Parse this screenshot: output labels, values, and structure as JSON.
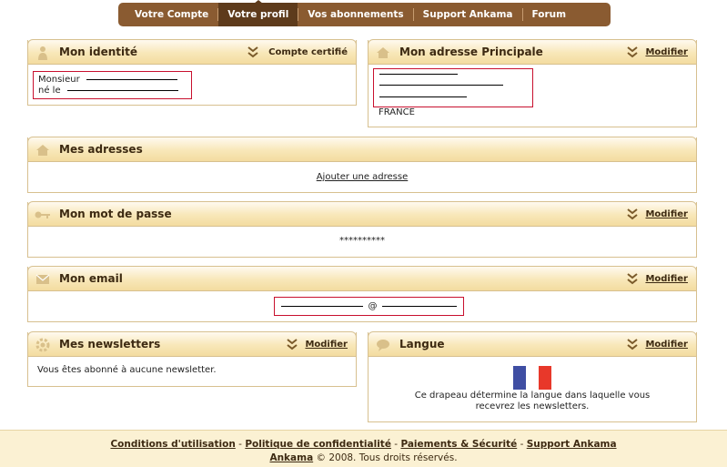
{
  "nav": {
    "tabs": [
      {
        "label": "Votre Compte"
      },
      {
        "label": "Votre profil"
      },
      {
        "label": "Vos abonnements"
      },
      {
        "label": "Support Ankama"
      },
      {
        "label": "Forum"
      }
    ],
    "active": "Votre profil"
  },
  "identity": {
    "title": "Mon identité",
    "badge": "Compte certifié",
    "civility": "Monsieur",
    "born_label": "né le"
  },
  "address": {
    "title": "Mon adresse Principale",
    "modify": "Modifier",
    "country": "FRANCE"
  },
  "addresses": {
    "title": "Mes adresses",
    "add_link": "Ajouter une adresse"
  },
  "password": {
    "title": "Mon mot de passe",
    "modify": "Modifier",
    "masked": "**********"
  },
  "email": {
    "title": "Mon email",
    "modify": "Modifier",
    "at": "@"
  },
  "newsletters": {
    "title": "Mes newsletters",
    "modify": "Modifier",
    "text": "Vous êtes abonné à aucune newsletter."
  },
  "language": {
    "title": "Langue",
    "modify": "Modifier",
    "flag": "france-flag",
    "flag_colors": [
      "#3f4ea3",
      "#ffffff",
      "#e8382a"
    ],
    "text": "Ce drapeau détermine la langue dans laquelle vous recevrez les newsletters."
  },
  "footer": {
    "links": [
      "Conditions d'utilisation",
      "Politique de confidentialité",
      "Paiements & Sécurité",
      "Support Ankama"
    ],
    "separator": "-",
    "brand": "Ankama",
    "copyright": "© 2008. Tous droits réservés."
  },
  "colors": {
    "nav_bg": "#8a5b31",
    "nav_active": "#5e3b1c",
    "panel_border": "#d7c08f",
    "header_gradient_end": "#f3dca0",
    "redbox": "#c8102e",
    "footer_bg": "#fbf1d3"
  }
}
